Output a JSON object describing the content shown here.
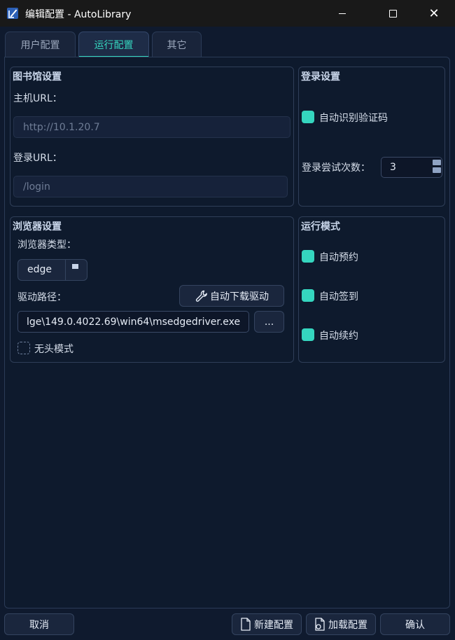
{
  "window": {
    "title": "编辑配置 - AutoLibrary",
    "min_label": "",
    "close_label": "✕"
  },
  "tabs": [
    {
      "label": "用户配置",
      "active": false
    },
    {
      "label": "运行配置",
      "active": true
    },
    {
      "label": "其它",
      "active": false
    }
  ],
  "library": {
    "title": "图书馆设置",
    "host_label": "主机URL：",
    "host_placeholder": "http://10.1.20.7",
    "login_label": "登录URL：",
    "login_placeholder": "/login"
  },
  "login_settings": {
    "title": "登录设置",
    "auto_captcha_label": "自动识别验证码",
    "auto_captcha_checked": true,
    "attempts_label": "登录尝试次数：",
    "attempts_value": "3"
  },
  "browser": {
    "title": "浏览器设置",
    "type_label": "浏览器类型：",
    "type_value": "edge",
    "driver_label": "驱动路径：",
    "auto_download_label": "自动下载驱动",
    "driver_path": "lge\\149.0.4022.69\\win64\\msedgedriver.exe",
    "browse_label": "...",
    "headless_label": "无头模式",
    "headless_checked": false
  },
  "run_mode": {
    "title": "运行模式",
    "items": [
      {
        "label": "自动预约",
        "checked": true
      },
      {
        "label": "自动签到",
        "checked": true
      },
      {
        "label": "自动续约",
        "checked": true
      }
    ]
  },
  "footer": {
    "cancel_label": "取消",
    "new_label": "新建配置",
    "load_label": "加载配置",
    "confirm_label": "确认"
  },
  "colors": {
    "accent": "#35d6bf",
    "background": "#0f1a2e",
    "titlebar": "#191919"
  }
}
